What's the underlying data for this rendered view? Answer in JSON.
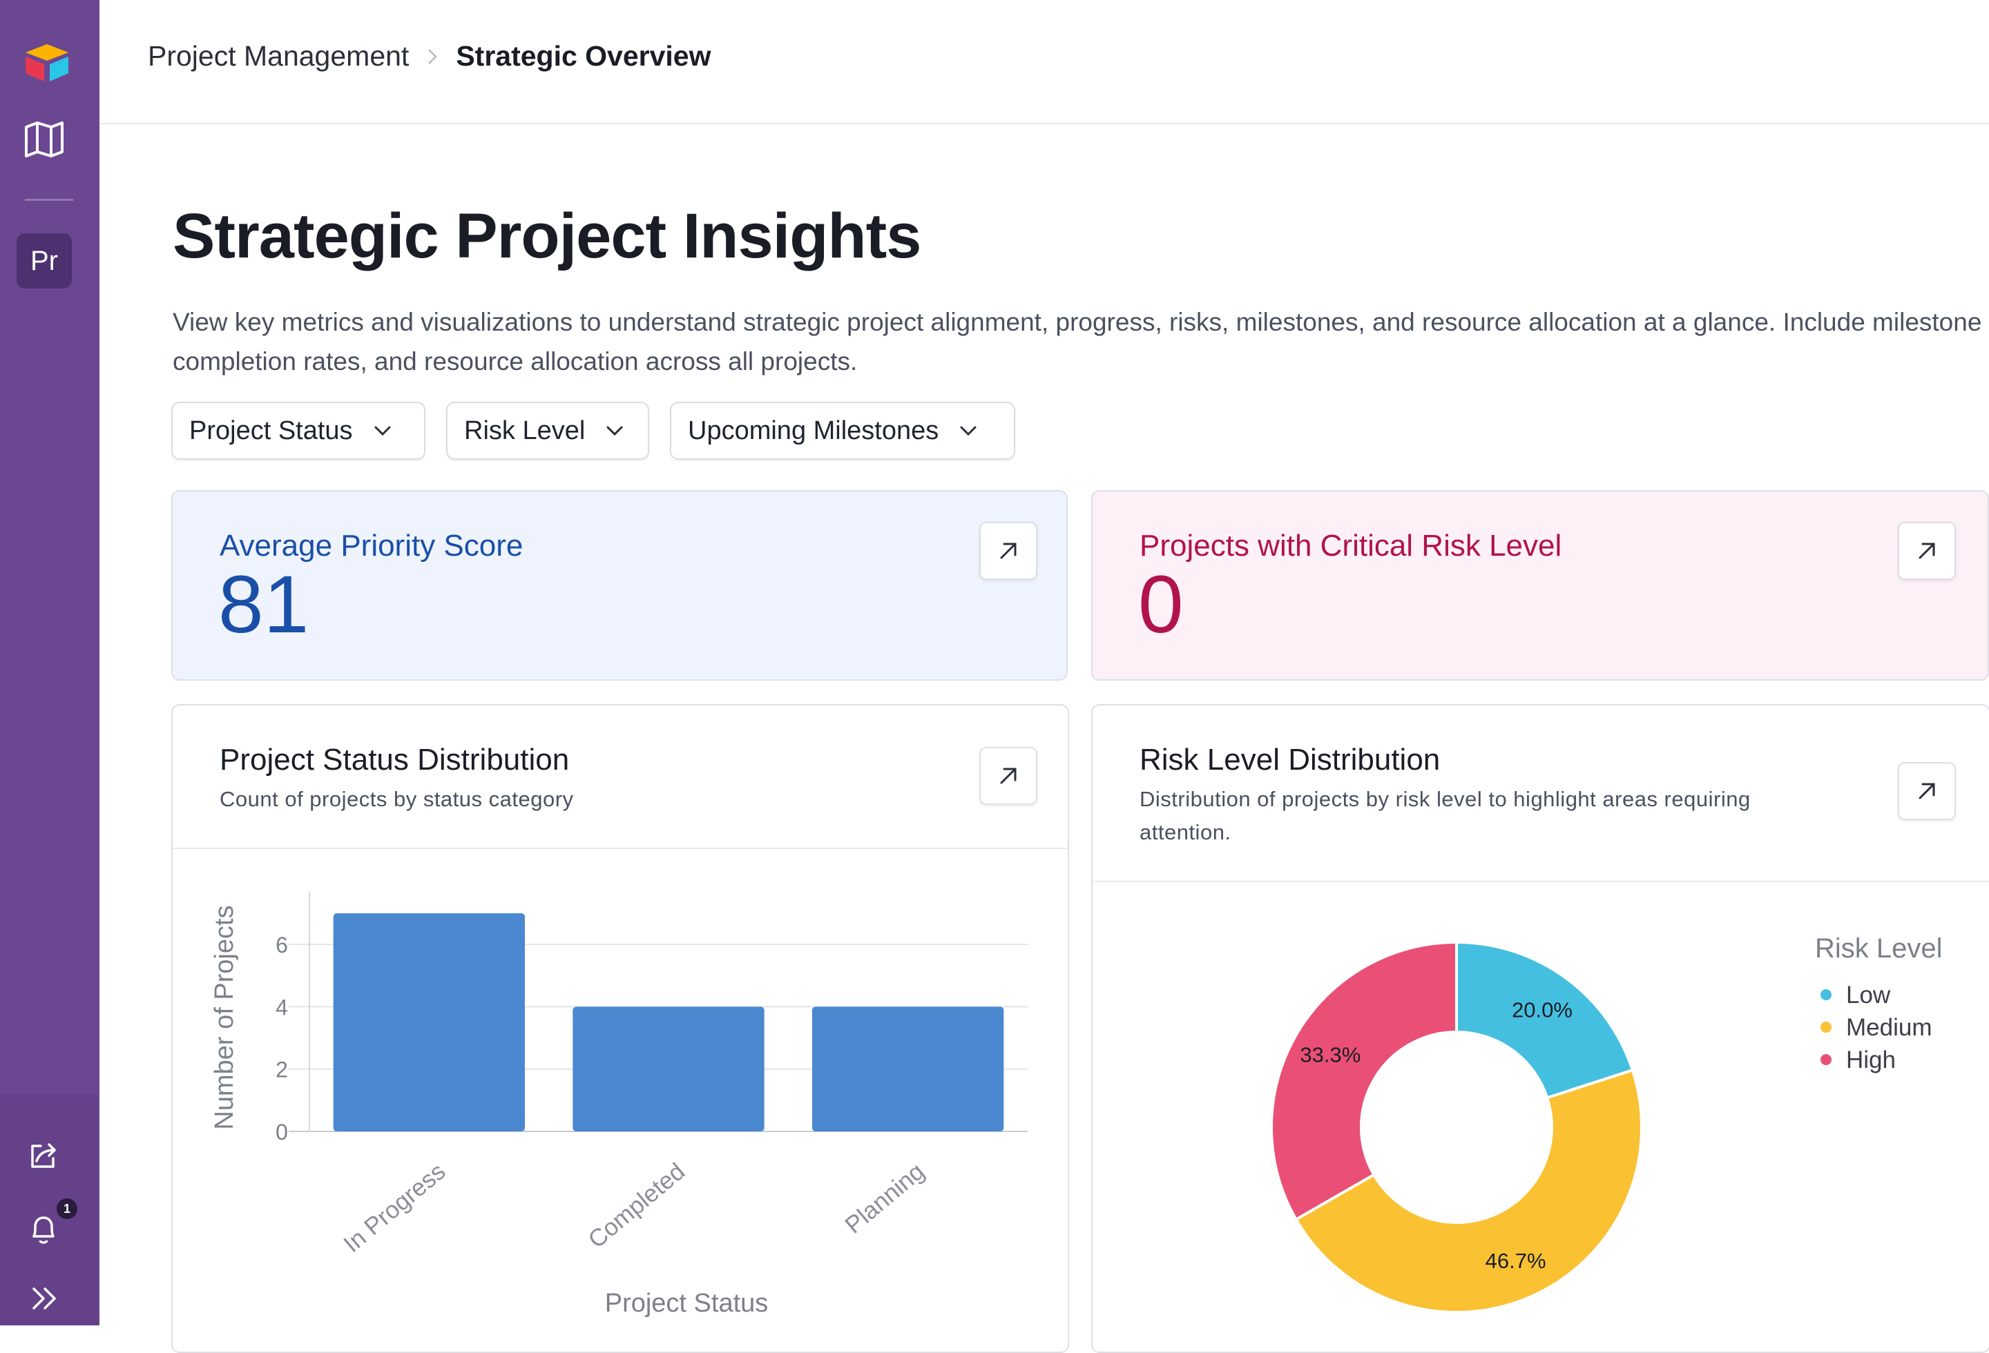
{
  "sidebar": {
    "workspace_badge": "Pr",
    "notification_count": "1"
  },
  "breadcrumb": {
    "root": "Project Management",
    "current": "Strategic Overview"
  },
  "page": {
    "title": "Strategic Project Insights",
    "description": "View key metrics and visualizations to understand strategic project alignment, progress, risks, milestones, and resource allocation at a glance. Include milestone completion rates, and resource allocation across all projects."
  },
  "filters": [
    "Project Status",
    "Risk Level",
    "Upcoming Milestones"
  ],
  "metrics": [
    {
      "label": "Average Priority Score",
      "value": "81",
      "color": "#1a4fa8",
      "bg": "#eef3fd"
    },
    {
      "label": "Projects with Critical Risk Level",
      "value": "0",
      "color": "#b0134a",
      "bg": "#fdf0f7"
    }
  ],
  "status_chart": {
    "title": "Project Status Distribution",
    "subtitle": "Count of projects by status category"
  },
  "risk_chart": {
    "title": "Risk Level Distribution",
    "subtitle": "Distribution of projects by risk level to highlight areas requiring attention."
  },
  "chart_data": [
    {
      "type": "bar",
      "categories": [
        "In Progress",
        "Completed",
        "Planning"
      ],
      "values": [
        7,
        4,
        4
      ],
      "xlabel": "Project Status",
      "ylabel": "Number of Projects",
      "yticks": [
        0,
        2,
        4,
        6
      ],
      "ylim": [
        0,
        7
      ],
      "grid": true,
      "color": "#4a88d0"
    },
    {
      "type": "pie",
      "donut": true,
      "legend_title": "Risk Level",
      "legend_position": "right",
      "slices": [
        {
          "name": "Low",
          "value": 20.0,
          "label": "20.0%",
          "color": "#45bfdf"
        },
        {
          "name": "Medium",
          "value": 46.7,
          "label": "46.7%",
          "color": "#fac133"
        },
        {
          "name": "High",
          "value": 33.3,
          "label": "33.3%",
          "color": "#ea4f75"
        }
      ]
    }
  ]
}
